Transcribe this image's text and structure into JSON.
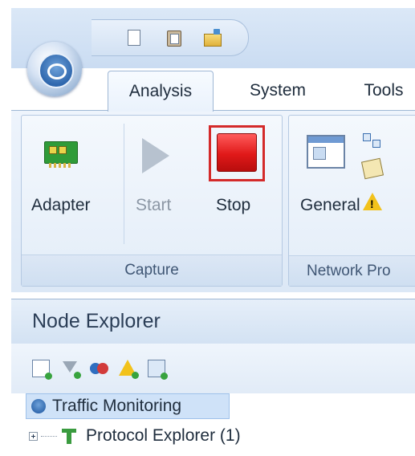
{
  "ribbon": {
    "tabs": [
      {
        "label": "Analysis",
        "active": true
      },
      {
        "label": "System",
        "active": false
      },
      {
        "label": "Tools",
        "active": false
      }
    ],
    "groups": {
      "capture": {
        "label": "Capture",
        "buttons": {
          "adapter": {
            "label": "Adapter",
            "icon": "network-adapter-icon",
            "enabled": true
          },
          "start": {
            "label": "Start",
            "icon": "play-icon",
            "enabled": false
          },
          "stop": {
            "label": "Stop",
            "icon": "stop-icon",
            "enabled": true,
            "highlighted": true
          }
        }
      },
      "network_profiles": {
        "label": "Network Pro",
        "buttons": {
          "general": {
            "label": "General",
            "icon": "window-icon"
          }
        }
      }
    }
  },
  "quick_access": [
    "new-document-icon",
    "paste-icon",
    "open-folder-icon"
  ],
  "node_explorer": {
    "title": "Node Explorer",
    "toolbar_icons": [
      "add-view-icon",
      "add-filter-icon",
      "add-group-icon",
      "add-alert-icon",
      "add-report-icon"
    ],
    "tree": [
      {
        "label": "Traffic Monitoring",
        "selected": true,
        "icon": "traffic-icon"
      },
      {
        "label": "Protocol Explorer (1)",
        "selected": false,
        "icon": "protocol-icon",
        "expandable": true
      }
    ]
  },
  "colors": {
    "highlight_border": "#d42a2a",
    "stop_red": "#e01919",
    "ribbon_blue": "#dce8f6",
    "selection": "#cfe2f8"
  }
}
